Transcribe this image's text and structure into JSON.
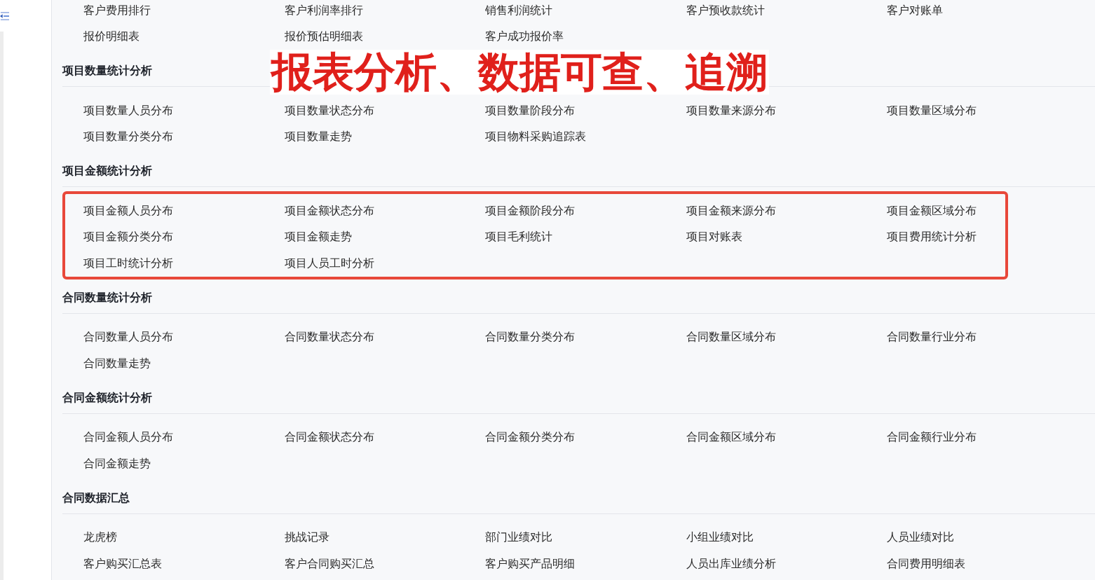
{
  "overlay_caption": "报表分析、数据可查、追溯",
  "sections": [
    {
      "highlighted": false,
      "items": [
        "客户费用排行",
        "客户利润率排行",
        "销售利润统计",
        "客户预收款统计",
        "客户对账单",
        "报价明细表",
        "报价预估明细表",
        "客户成功报价率"
      ]
    },
    {
      "title": "项目数量统计分析",
      "highlighted": false,
      "items": [
        "项目数量人员分布",
        "项目数量状态分布",
        "项目数量阶段分布",
        "项目数量来源分布",
        "项目数量区域分布",
        "项目数量分类分布",
        "项目数量走势",
        "项目物料采购追踪表"
      ]
    },
    {
      "title": "项目金额统计分析",
      "highlighted": true,
      "items": [
        "项目金额人员分布",
        "项目金额状态分布",
        "项目金额阶段分布",
        "项目金额来源分布",
        "项目金额区域分布",
        "项目金额分类分布",
        "项目金额走势",
        "项目毛利统计",
        "项目对账表",
        "项目费用统计分析",
        "项目工时统计分析",
        "项目人员工时分析"
      ]
    },
    {
      "title": "合同数量统计分析",
      "highlighted": false,
      "items": [
        "合同数量人员分布",
        "合同数量状态分布",
        "合同数量分类分布",
        "合同数量区域分布",
        "合同数量行业分布",
        "合同数量走势"
      ]
    },
    {
      "title": "合同金额统计分析",
      "highlighted": false,
      "items": [
        "合同金额人员分布",
        "合同金额状态分布",
        "合同金额分类分布",
        "合同金额区域分布",
        "合同金额行业分布",
        "合同金额走势"
      ]
    },
    {
      "title": "合同数据汇总",
      "highlighted": false,
      "items": [
        "龙虎榜",
        "挑战记录",
        "部门业绩对比",
        "小组业绩对比",
        "人员业绩对比",
        "客户购买汇总表",
        "客户合同购买汇总",
        "客户购买产品明细",
        "人员出库业绩分析",
        "合同费用明细表"
      ]
    }
  ]
}
